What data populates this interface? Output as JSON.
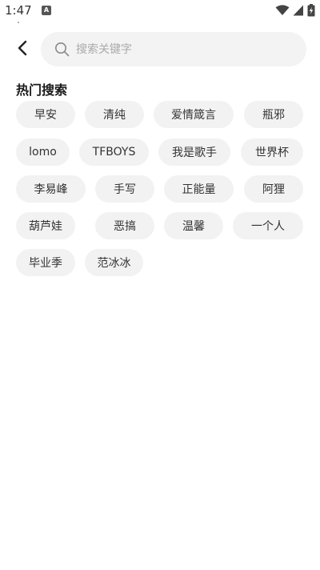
{
  "status_bar": {
    "time": "1:47",
    "notification_badge": "A"
  },
  "search": {
    "placeholder": "搜索关键字",
    "value": ""
  },
  "hot_search": {
    "title": "热门搜索",
    "tags": [
      "早安",
      "清纯",
      "爱情箴言",
      "瓶邪",
      "lomo",
      "TFBOYS",
      "我是歌手",
      "世界杯",
      "李易峰",
      "手写",
      "正能量",
      "阿狸",
      "葫芦娃",
      "恶搞",
      "温馨",
      "一个人",
      "毕业季",
      "范冰冰"
    ]
  },
  "colors": {
    "tag_background": "#f2f2f2",
    "search_background": "#f3f3f3",
    "placeholder_text": "#aaaaaa",
    "title_text": "#1a1a1a"
  },
  "icons": {
    "back": "chevron-left-icon",
    "search": "search-icon",
    "wifi": "wifi-icon",
    "signal": "signal-icon",
    "battery": "battery-charging-icon"
  }
}
